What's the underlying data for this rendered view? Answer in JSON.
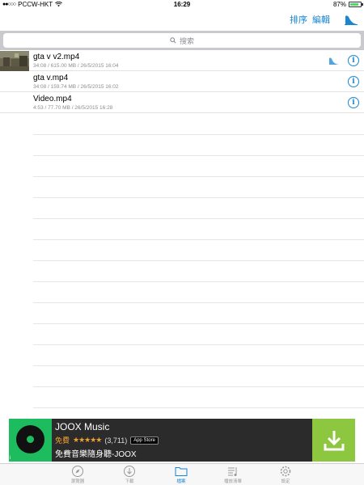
{
  "status": {
    "carrier": "PCCW-HKT",
    "time": "16:29",
    "battery": "87%",
    "battery_level": 0.87
  },
  "nav": {
    "sort_label": "排序",
    "edit_label": "編輯"
  },
  "search": {
    "placeholder": "搜索"
  },
  "files": [
    {
      "name": "gta v v2.mp4",
      "meta": "34:08 / 615.00 MB / 26/5/2015 16:04",
      "thumb": true,
      "wave": true
    },
    {
      "name": "gta v.mp4",
      "meta": "34:08 / 159.74 MB / 26/5/2015 16:02",
      "thumb": false,
      "wave": false
    },
    {
      "name": "Video.mp4",
      "meta": "4:53 / 77.70 MB / 26/5/2015 16:28",
      "thumb": false,
      "wave": false
    }
  ],
  "ad": {
    "title": "JOOX Music",
    "price": "免費",
    "stars": "★★★★★",
    "rating_count": "(3,711)",
    "store_badge": "App Store",
    "subtitle": "免費音樂隨身聽-JOOX",
    "info_mark": "i"
  },
  "tabs": [
    {
      "label": "瀏覽器",
      "icon": "compass-icon",
      "active": false
    },
    {
      "label": "下載",
      "icon": "download-icon",
      "active": false
    },
    {
      "label": "檔案",
      "icon": "folder-icon",
      "active": true
    },
    {
      "label": "播放清單",
      "icon": "playlist-icon",
      "active": false
    },
    {
      "label": "設定",
      "icon": "gear-icon",
      "active": false
    }
  ],
  "colors": {
    "accent": "#1a86d0",
    "ad_logo": "#1dbd5f",
    "ad_download": "#8dc63f"
  }
}
